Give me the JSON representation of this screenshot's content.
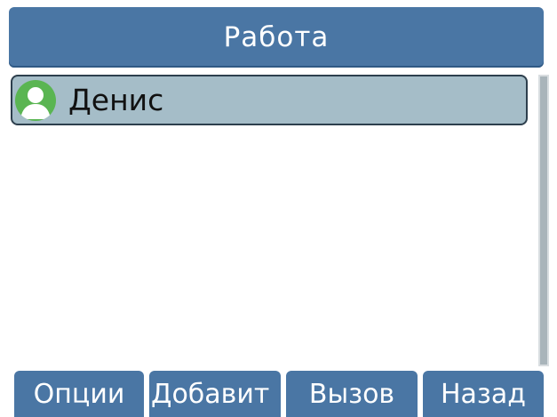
{
  "header": {
    "title": "Работа"
  },
  "contacts": [
    {
      "name": "Денис",
      "icon": "contact-avatar-icon",
      "selected": true
    }
  ],
  "softkeys": {
    "options": "Опции",
    "add": "Добавит",
    "call": "Вызов",
    "back": "Назад"
  },
  "colors": {
    "bar": "#4a76a4",
    "selected_row": "#a5bdc8",
    "avatar": "#5ab552"
  }
}
